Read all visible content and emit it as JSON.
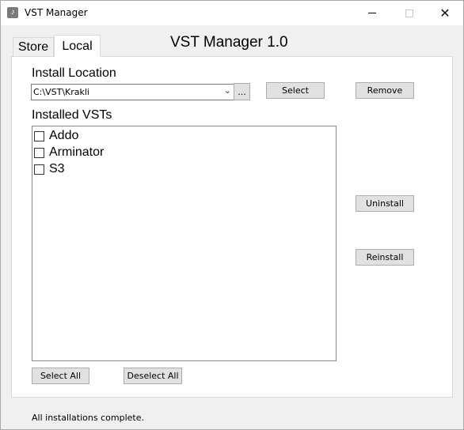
{
  "window": {
    "title": "VST Manager",
    "controls": {
      "minimize": "minimize-icon",
      "maximize": "maximize-icon",
      "close": "close-icon"
    }
  },
  "tabs": [
    {
      "label": "Store",
      "active": false
    },
    {
      "label": "Local",
      "active": true
    }
  ],
  "app_title": "VST Manager 1.0",
  "install_location": {
    "label": "Install Location",
    "value": "C:\\VST\\Krakli",
    "browse_label": "...",
    "select_label": "Select",
    "remove_label": "Remove"
  },
  "installed": {
    "label": "Installed VSTs",
    "items": [
      {
        "label": "Addo",
        "checked": false
      },
      {
        "label": "Arminator",
        "checked": false
      },
      {
        "label": "S3",
        "checked": false
      }
    ],
    "uninstall_label": "Uninstall",
    "reinstall_label": "Reinstall",
    "select_all_label": "Select All",
    "deselect_all_label": "Deselect All"
  },
  "status": "All installations complete.",
  "colors": {
    "window_bg": "#f0f0f0",
    "panel_bg": "#ffffff",
    "button_bg": "#e1e1e1",
    "button_border": "#adadad"
  }
}
